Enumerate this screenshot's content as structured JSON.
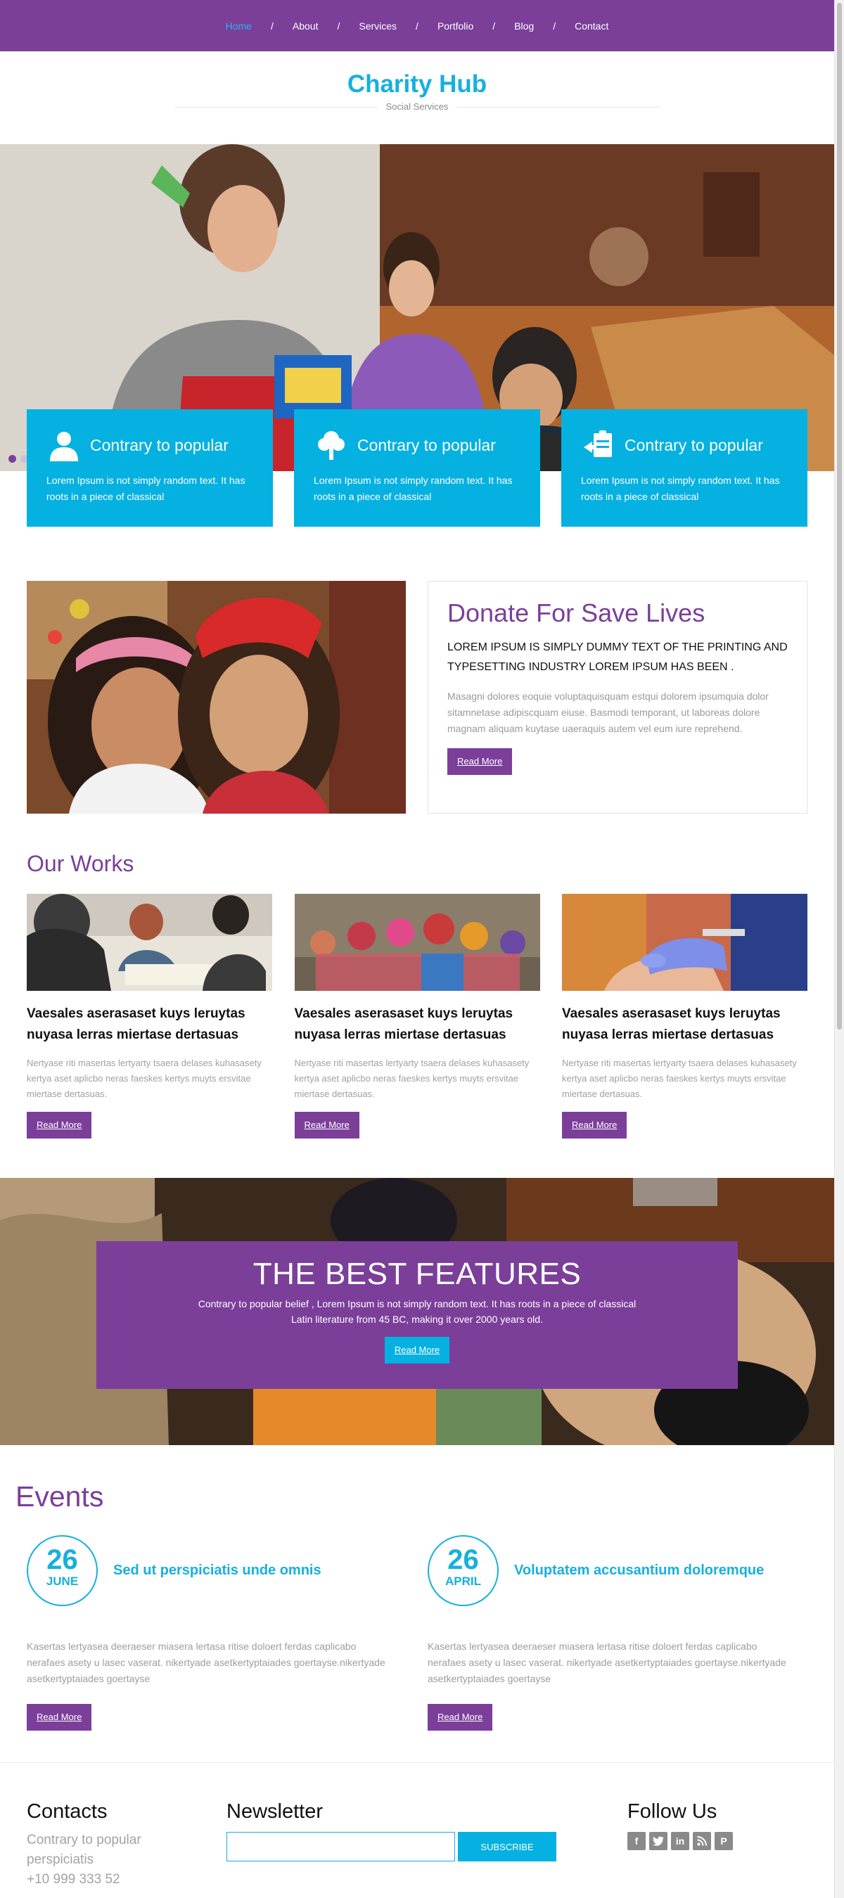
{
  "nav": {
    "items": [
      {
        "label": "Home",
        "active": true
      },
      {
        "label": "About",
        "active": false
      },
      {
        "label": "Services",
        "active": false
      },
      {
        "label": "Portfolio",
        "active": false
      },
      {
        "label": "Blog",
        "active": false
      },
      {
        "label": "Contact",
        "active": false
      }
    ],
    "separator": "/"
  },
  "brand": {
    "title": "Charity Hub",
    "tagline": "Social Services"
  },
  "hero": {
    "cards": [
      {
        "icon": "person-icon",
        "title": "Contrary to popular",
        "text": "Lorem Ipsum is not simply random text. It has roots in a piece of classical"
      },
      {
        "icon": "tree-icon",
        "title": "Contrary to popular",
        "text": "Lorem Ipsum is not simply random text. It has roots in a piece of classical"
      },
      {
        "icon": "clipboard-icon",
        "title": "Contrary to popular",
        "text": "Lorem Ipsum is not simply random text. It has roots in a piece of classical"
      }
    ]
  },
  "donate": {
    "title": "Donate For Save Lives",
    "lead": "LOREM IPSUM IS SIMPLY DUMMY TEXT OF THE PRINTING AND TYPESETTING INDUSTRY LOREM IPSUM HAS BEEN .",
    "body": "Masagni dolores eoquie voluptaquisquam estqui dolorem ipsumquia dolor sitamnetase adipiscquam eiuse. Basmodi temporant, ut laboreas dolore magnam aliquam kuytase uaeraquis autem vel eum iure reprehend.",
    "button": "Read More"
  },
  "works": {
    "title": "Our Works",
    "items": [
      {
        "title": "Vaesales aserasaset kuys leruytas nuyasa lerras miertase dertasuas",
        "text": "Nertyase riti masertas lertyarty tsaera delases kuhasasety kertya aset aplicbo neras faeskes kertys muyts ersvitae miertase dertasuas.",
        "button": "Read More"
      },
      {
        "title": "Vaesales aserasaset kuys leruytas nuyasa lerras miertase dertasuas",
        "text": "Nertyase riti masertas lertyarty tsaera delases kuhasasety kertya aset aplicbo neras faeskes kertys muyts ersvitae miertase dertasuas.",
        "button": "Read More"
      },
      {
        "title": "Vaesales aserasaset kuys leruytas nuyasa lerras miertase dertasuas",
        "text": "Nertyase riti masertas lertyarty tsaera delases kuhasasety kertya aset aplicbo neras faeskes kertys muyts ersvitae miertase dertasuas.",
        "button": "Read More"
      }
    ]
  },
  "features": {
    "title": "THE BEST FEATURES",
    "text": "Contrary to popular belief , Lorem Ipsum is not simply random text. It has roots in a piece of classical Latin literature from 45 BC, making it over 2000 years old.",
    "button": "Read More"
  },
  "events": {
    "title": "Events",
    "items": [
      {
        "day": "26",
        "month": "JUNE",
        "title": "Sed ut perspiciatis unde omnis",
        "text": "Kasertas lertyasea deeraeser miasera lertasa ritise doloert ferdas caplicabo nerafaes asety u lasec vaserat. nikertyade asetkertyptaiades goertayse.nikertyade asetkertyptaiades goertayse",
        "button": "Read More"
      },
      {
        "day": "26",
        "month": "APRIL",
        "title": "Voluptatem accusantium doloremque",
        "text": "Kasertas lertyasea deeraeser miasera lertasa ritise doloert ferdas caplicabo nerafaes asety u lasec vaserat. nikertyade asetkertyptaiades goertayse.nikertyade asetkertyptaiades goertayse",
        "button": "Read More"
      }
    ]
  },
  "footer": {
    "contacts": {
      "title": "Contacts",
      "line1": "Contrary to popular perspiciatis",
      "phone": "+10 999 333 52"
    },
    "newsletter": {
      "title": "Newsletter",
      "placeholder": "",
      "button": "SUBSCRIBE"
    },
    "follow": {
      "title": "Follow Us",
      "icons": [
        "facebook-icon",
        "twitter-icon",
        "linkedin-icon",
        "rss-icon",
        "pinterest-icon"
      ]
    }
  },
  "colors": {
    "purple": "#7b3f9a",
    "cyan": "#05b1e0",
    "brand": "#16b0de"
  }
}
